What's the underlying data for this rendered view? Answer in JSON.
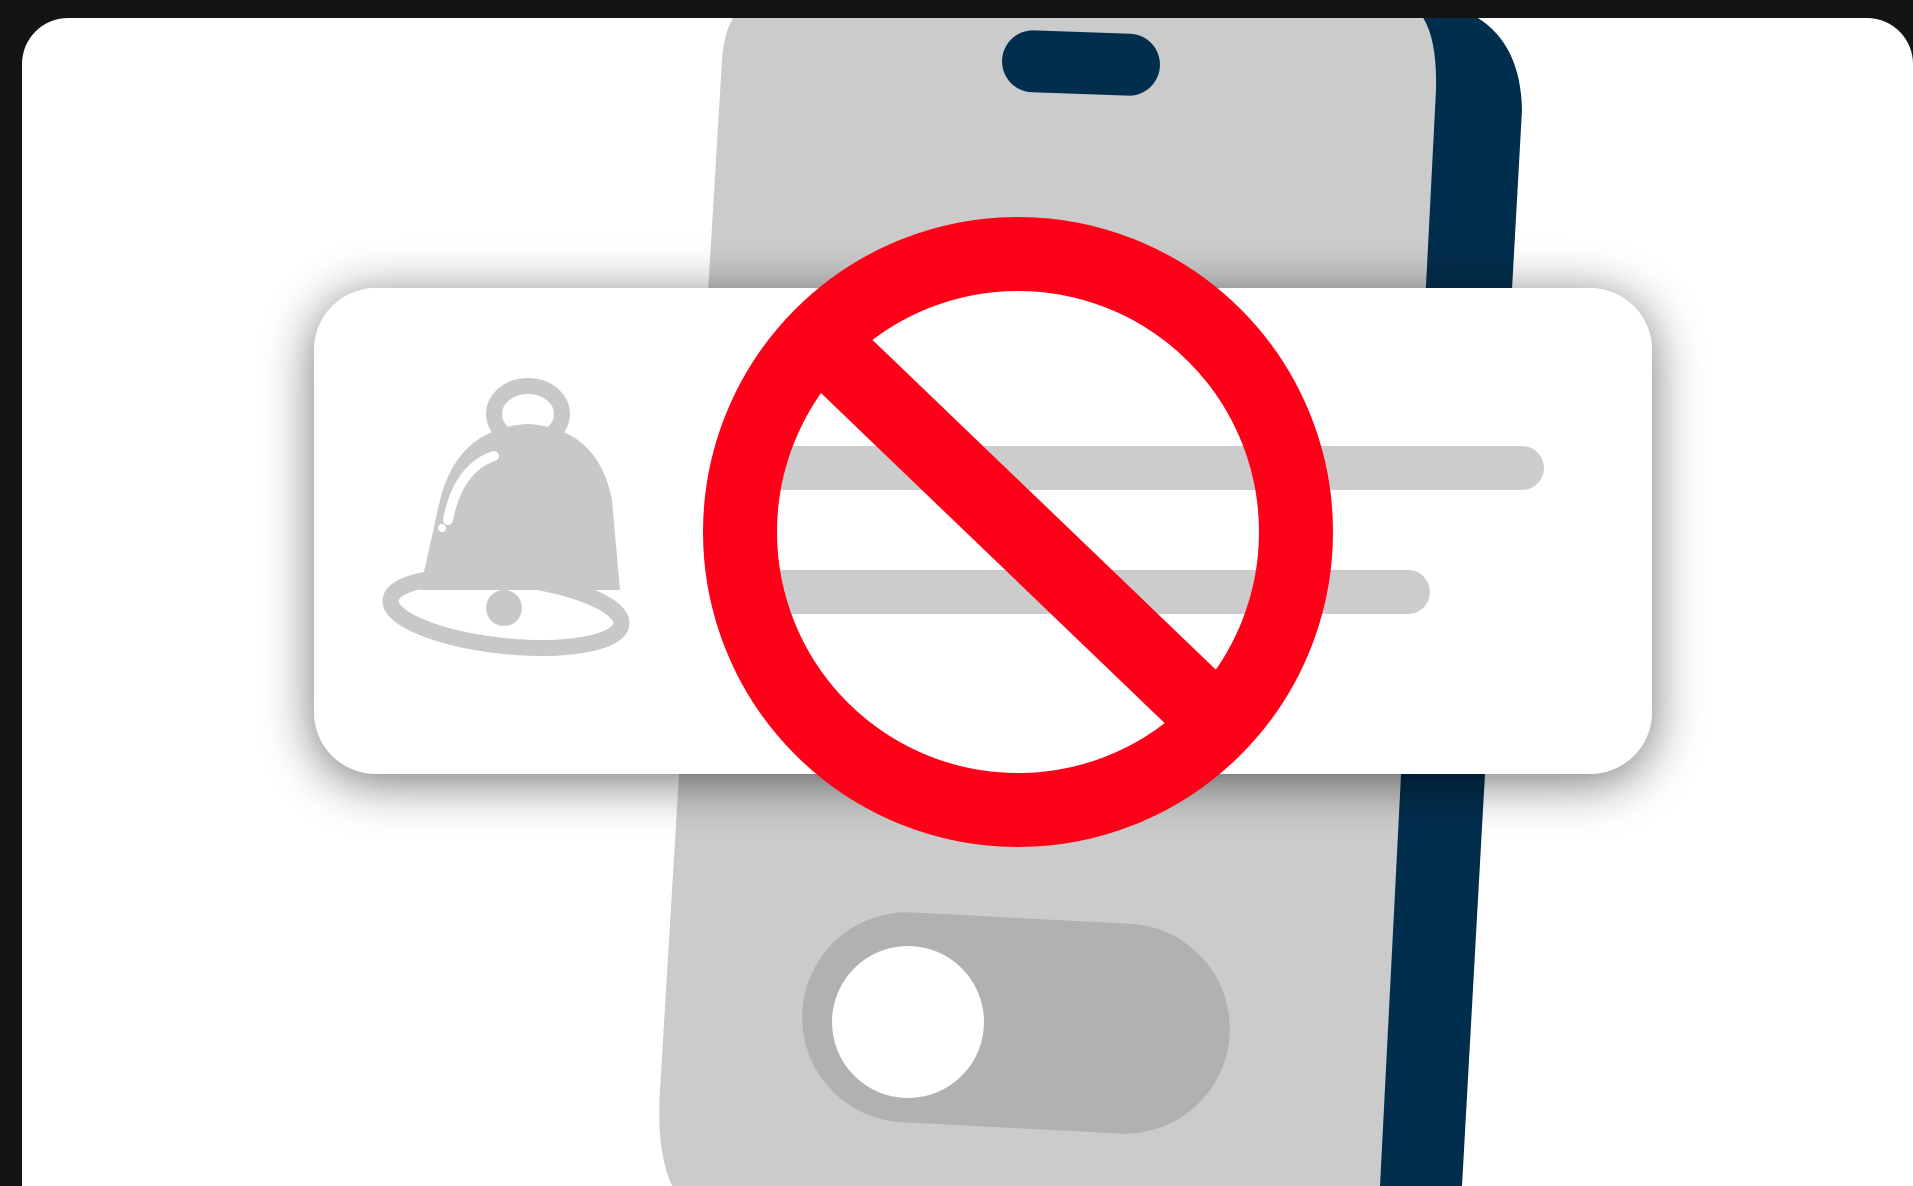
{
  "illustration": {
    "icons": [
      "smartphone-icon",
      "notification-banner",
      "bell-icon",
      "prohibited-sign-icon",
      "toggle-switch-icon"
    ],
    "colors": {
      "background": "#141414",
      "card": "#ffffff",
      "phone_body": "#cbcbcb",
      "phone_edge": "#022e4d",
      "notification_card": "#ffffff",
      "placeholder_lines": "#cccccc",
      "bell": "#c8c8c8",
      "prohibition": "#ff0018",
      "toggle_track": "#b1b1b1",
      "toggle_knob": "#ffffff"
    },
    "toggle_state": "off"
  }
}
